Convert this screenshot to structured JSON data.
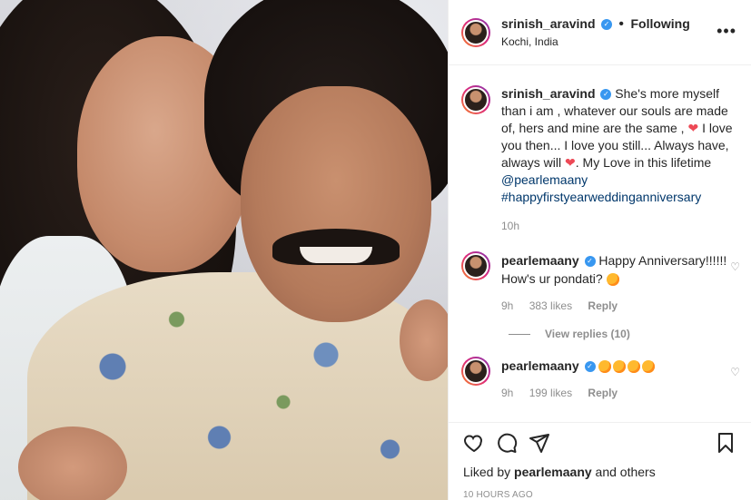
{
  "header": {
    "username": "srinish_aravind",
    "following_label": "Following",
    "location": "Kochi, India",
    "more_icon": "•••"
  },
  "caption": {
    "username": "srinish_aravind",
    "text_part1": "She's more myself than i am , whatever our souls are made of, hers and mine are the same , ",
    "heart": "❤",
    "text_part2": " I love you then... I love you still... Always have, always will ",
    "text_part3": ". My Love in this lifetime ",
    "mention": "@pearlemaany",
    "hashtag": "#happyfirstyearweddinganniversary",
    "time": "10h"
  },
  "comments": [
    {
      "username": "pearlemaany",
      "text": "Happy Anniversary!!!!!! How's ur pondati?",
      "time": "9h",
      "likes": "383 likes",
      "reply": "Reply",
      "view_replies": "View replies (10)"
    },
    {
      "username": "pearlemaany",
      "time": "9h",
      "likes": "199 likes",
      "reply": "Reply"
    }
  ],
  "footer": {
    "liked_prefix": "Liked by ",
    "liked_user": "pearlemaany",
    "liked_suffix": " and others",
    "time_ago": "10 HOURS AGO"
  },
  "icons": {
    "like": "heart-icon",
    "comment": "comment-icon",
    "share": "share-icon",
    "save": "bookmark-icon",
    "verified": "verified-badge-icon"
  },
  "colors": {
    "link": "#00376b",
    "verified": "#3897f0",
    "heart": "#ed4956",
    "muted": "#8e8e8e"
  }
}
